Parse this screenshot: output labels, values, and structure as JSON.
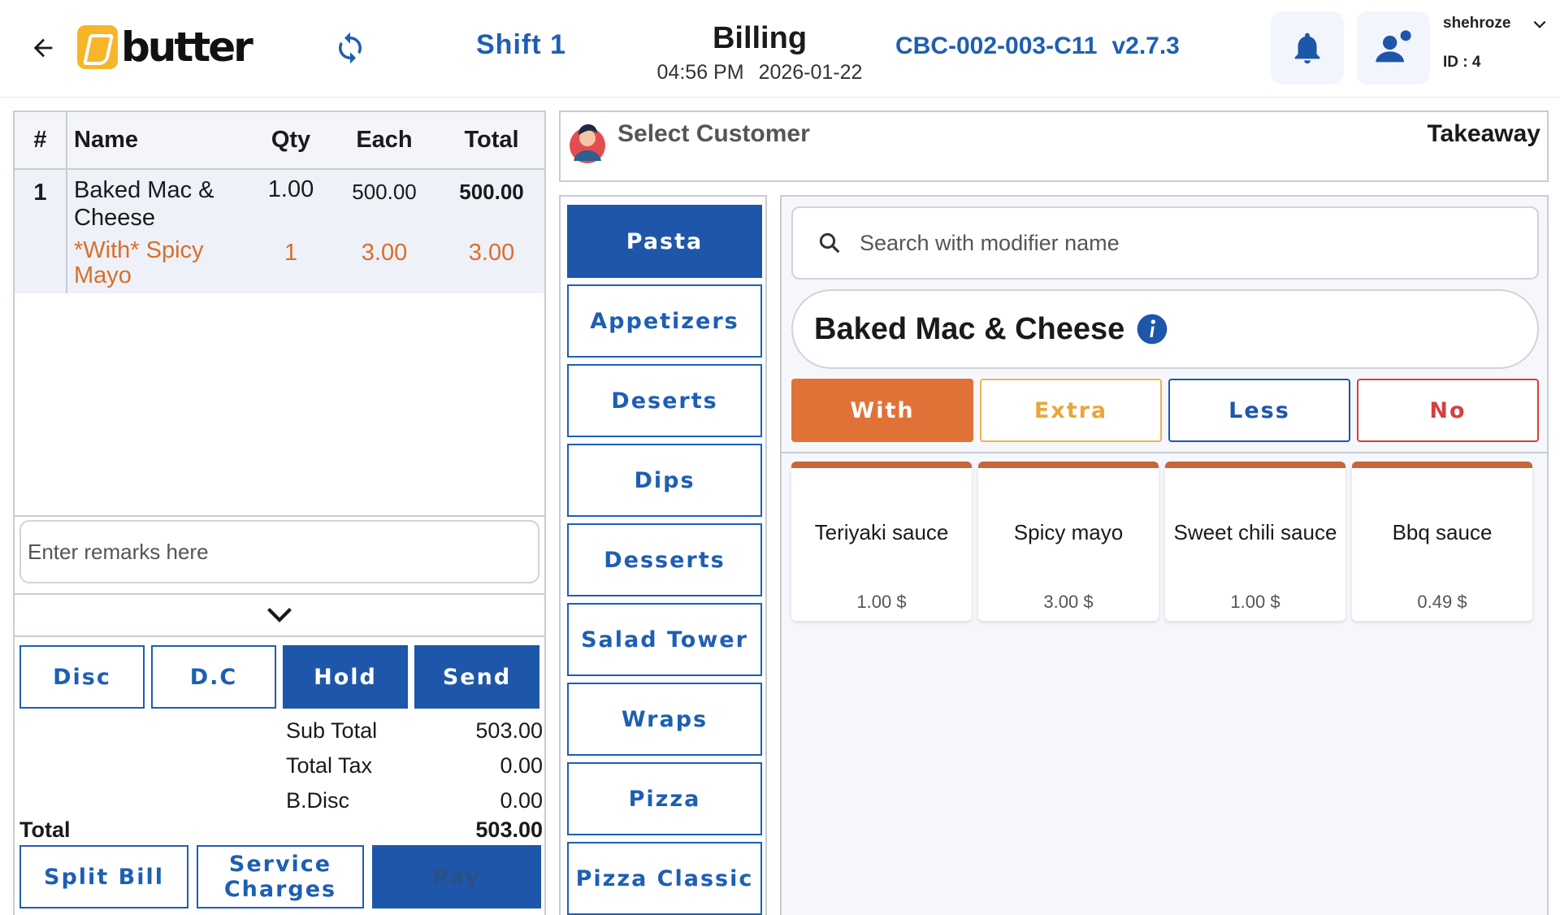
{
  "header": {
    "logo_text": "butter",
    "shift": "Shift 1",
    "title": "Billing",
    "time": "04:56 PM",
    "date": "2026-01-22",
    "terminal_id": "CBC-002-003-C11",
    "version": "v2.7.3",
    "username": "shehroze",
    "user_id": "ID : 4"
  },
  "order": {
    "columns": [
      "#",
      "Name",
      "Qty",
      "Each",
      "Total"
    ],
    "items": [
      {
        "num": "1",
        "name": "Baked Mac & Cheese",
        "qty": "1.00",
        "each": "500.00",
        "total": "500.00",
        "modifier": {
          "name": "*With* Spicy Mayo",
          "qty": "1",
          "each": "3.00",
          "total": "3.00"
        }
      }
    ],
    "remarks_placeholder": "Enter remarks here"
  },
  "actions": {
    "disc": "Disc",
    "dc": "D.C",
    "hold": "Hold",
    "send": "Send"
  },
  "totals": {
    "sub_total_label": "Sub Total",
    "sub_total": "503.00",
    "total_tax_label": "Total Tax",
    "total_tax": "0.00",
    "b_disc_label": "B.Disc",
    "b_disc": "0.00",
    "total_label": "Total",
    "total": "503.00"
  },
  "payment": {
    "split_bill": "Split Bill",
    "service_charges": "Service Charges",
    "pay": "Pay"
  },
  "customer": {
    "label": "Select Customer",
    "order_type": "Takeaway"
  },
  "categories": [
    "Pasta",
    "Appetizers",
    "Deserts",
    "Dips",
    "Desserts",
    "Salad Tower",
    "Wraps",
    "Pizza",
    "Pizza Classic"
  ],
  "active_category": "Pasta",
  "modifiers": {
    "search_placeholder": "Search with modifier name",
    "item_title": "Baked Mac & Cheese",
    "types": [
      "With",
      "Extra",
      "Less",
      "No"
    ],
    "active_type": "With",
    "items": [
      {
        "name": "Teriyaki sauce",
        "price": "1.00 $"
      },
      {
        "name": "Spicy mayo",
        "price": "3.00 $"
      },
      {
        "name": "Sweet chili sauce",
        "price": "1.00 $"
      },
      {
        "name": "Bbq sauce",
        "price": "0.49 $"
      }
    ]
  },
  "colors": {
    "primary_blue": "#1e56aa",
    "accent_orange": "#e07238",
    "extra_yellow": "#f0b34f",
    "no_red": "#d2413e",
    "modifier_text": "#d86f2d"
  }
}
